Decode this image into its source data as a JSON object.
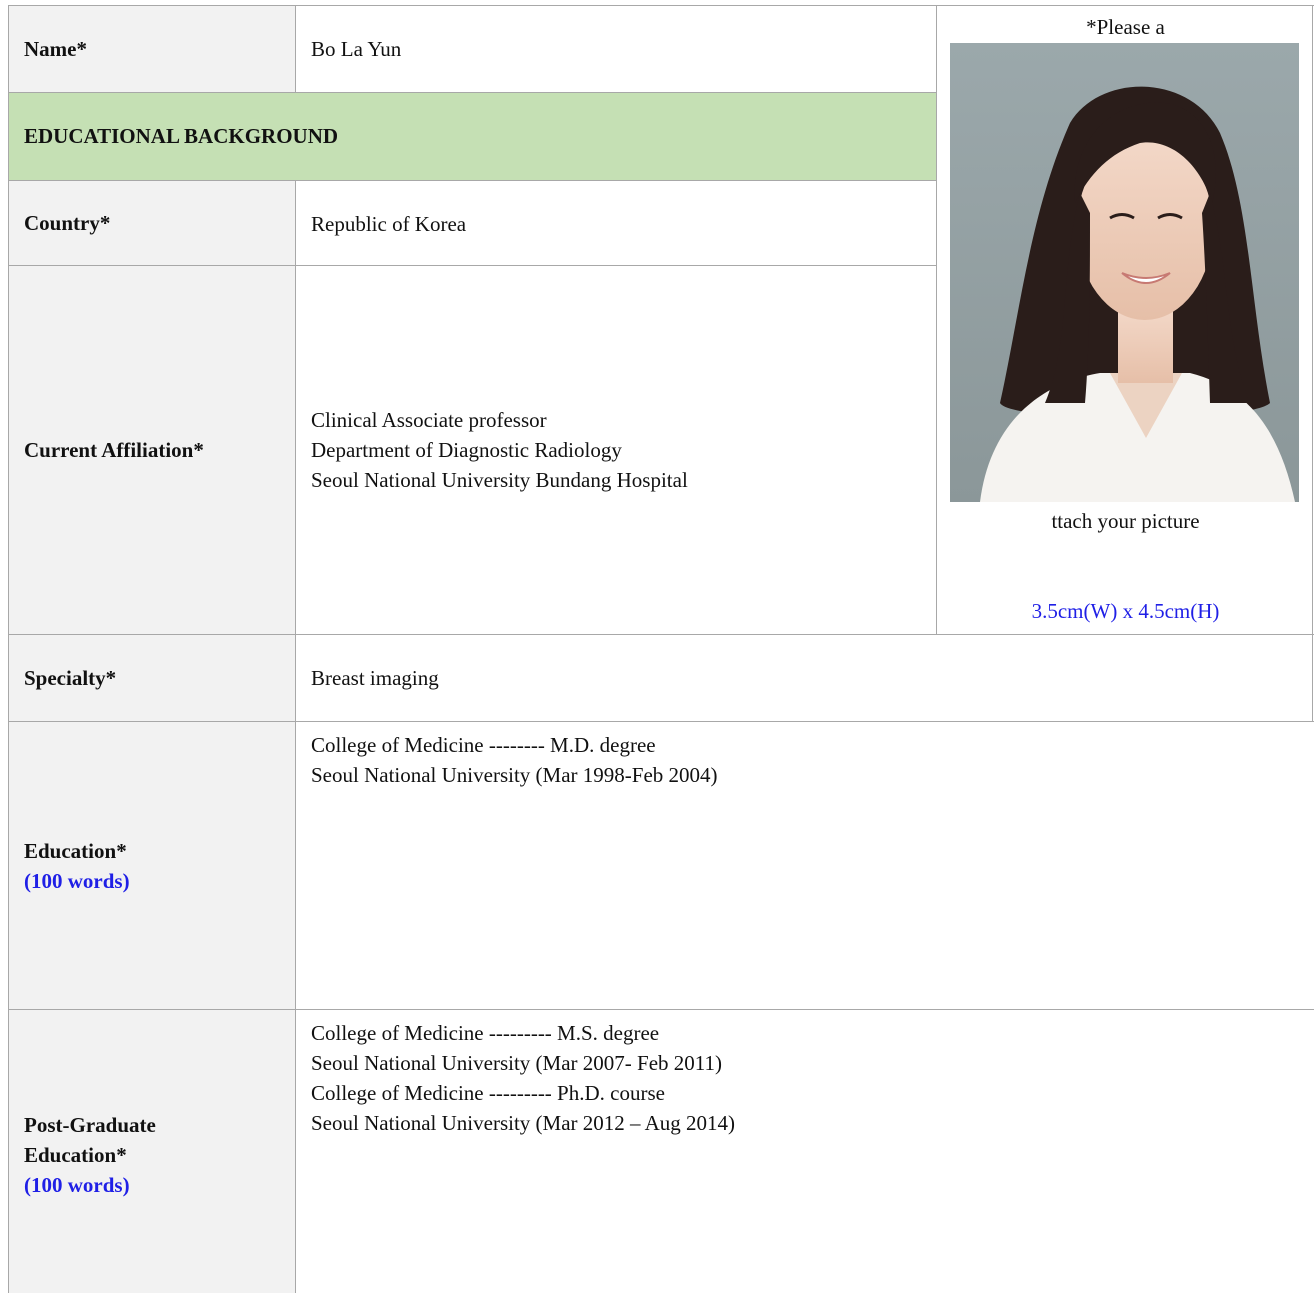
{
  "form": {
    "name_label": "Name*",
    "name_value": "Bo La Yun",
    "section_title": "EDUCATIONAL BACKGROUND",
    "country_label": "Country*",
    "country_value": "Republic of Korea",
    "affiliation_label": "Current Affiliation*",
    "affiliation_lines": [
      "Clinical Associate professor",
      "Department of Diagnostic Radiology",
      "Seoul National University Bundang Hospital"
    ],
    "specialty_label": "Specialty*",
    "specialty_value": "Breast imaging",
    "education_label": "Education*",
    "education_note": "(100 words)",
    "education_lines": [
      "College of Medicine    -------- M.D. degree",
      "Seoul National University (Mar 1998-Feb 2004)"
    ],
    "postgrad_label_1": "Post-Graduate",
    "postgrad_label_2": "Education*",
    "postgrad_note": "(100 words)",
    "postgrad_lines": [
      "College of Medicine    --------- M.S. degree",
      "Seoul National University (Mar 2007- Feb 2011)",
      "College of Medicine    --------- Ph.D. course",
      "Seoul National University (Mar 2012 – Aug 2014)"
    ]
  },
  "photo": {
    "caption_top": "*Please a",
    "caption_bottom": "ttach your picture",
    "size_note": "3.5cm(W) x 4.5cm(H)"
  },
  "colors": {
    "section_bg": "#c5e0b4",
    "label_bg": "#f2f2f2",
    "note_blue": "#1f1fe6",
    "border": "#a8a8a8"
  }
}
